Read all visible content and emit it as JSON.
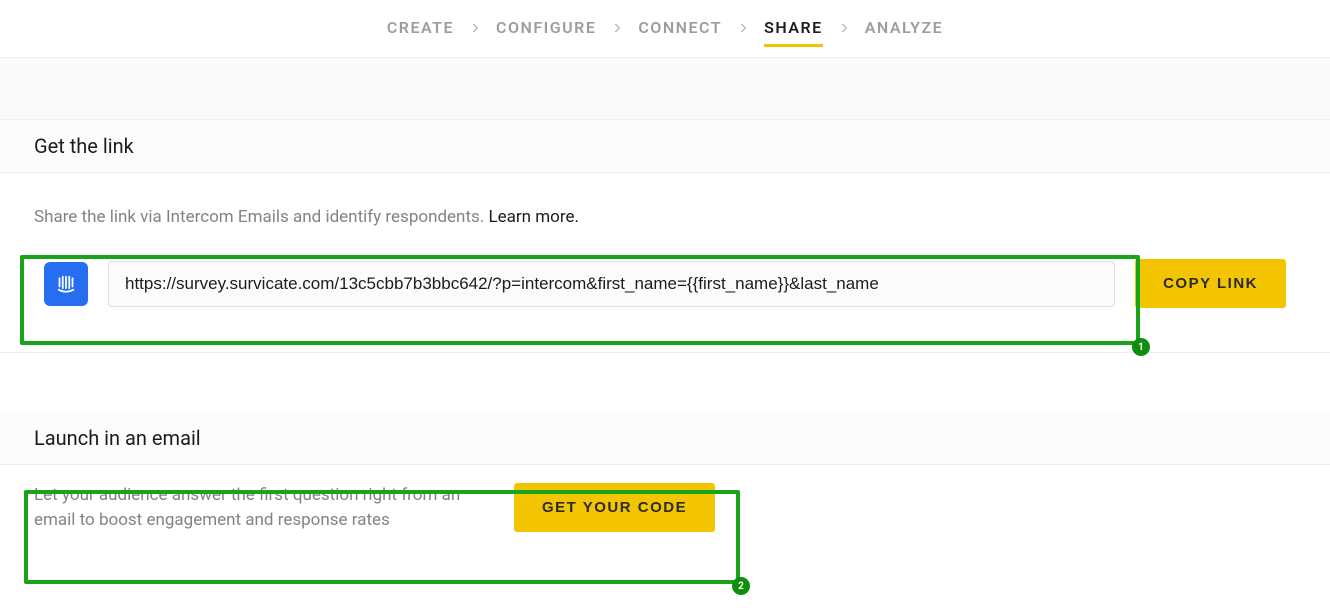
{
  "breadcrumb": {
    "items": [
      "CREATE",
      "CONFIGURE",
      "CONNECT",
      "SHARE",
      "ANALYZE"
    ],
    "active_index": 3
  },
  "section_link": {
    "title": "Get the link",
    "help_prefix": "Share the link via Intercom Emails and identify respondents. ",
    "help_learn": "Learn more.",
    "url_value": "https://survey.survicate.com/13c5cbb7b3bbc642/?p=intercom&first_name={{first_name}}&last_name",
    "copy_button": "COPY LINK"
  },
  "section_email": {
    "title": "Launch in an email",
    "desc": "Let your audience answer the first question right from an email to boost engagement and response rates",
    "code_button": "GET YOUR CODE"
  },
  "annotations": {
    "badge1": "1",
    "badge2": "2"
  }
}
